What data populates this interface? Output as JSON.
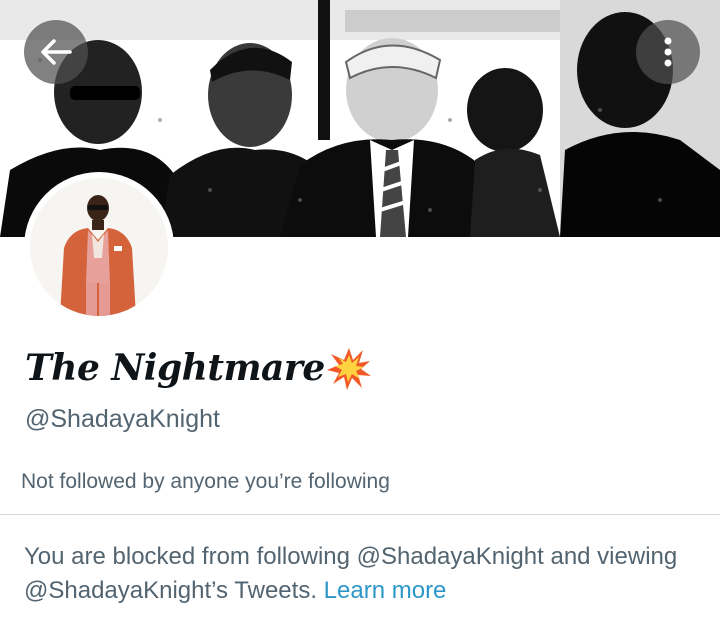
{
  "header": {
    "back_icon": "arrow-left-icon",
    "more_icon": "more-vertical-icon"
  },
  "profile": {
    "display_name": "The Nightmare",
    "name_emoji": "collision-icon",
    "handle": "@ShadayaKnight",
    "followers_note": "Not followed by anyone you’re following"
  },
  "blocked_notice": {
    "text": "You are blocked from following @ShadayaKnight and viewing @ShadayaKnight’s Tweets. ",
    "link": "Learn more"
  },
  "colors": {
    "text_primary": "#0f1419",
    "text_secondary": "#536471",
    "link": "#2d97c9",
    "divider": "#cfd9de",
    "avatar_suit": "#d4623a"
  }
}
